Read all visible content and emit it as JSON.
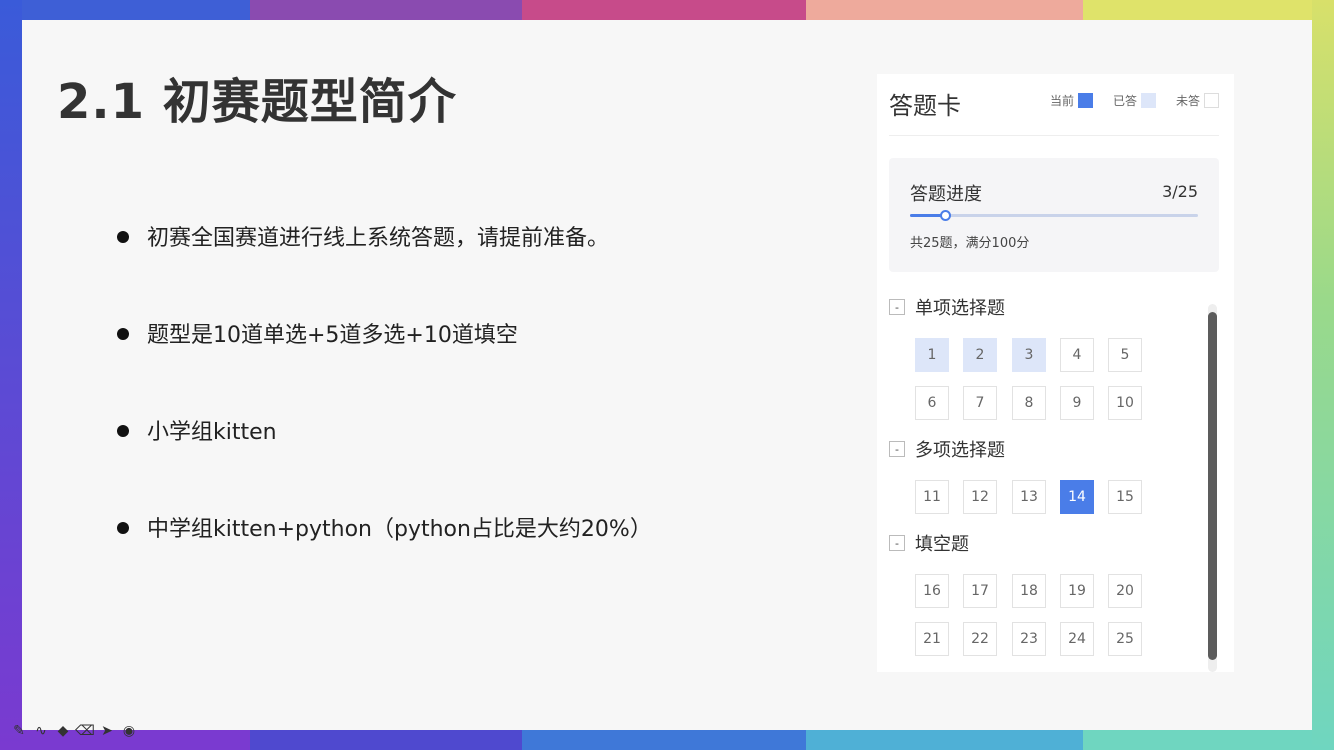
{
  "slide": {
    "title": "2.1 初赛题型简介",
    "bullets": [
      "初赛全国赛道进行线上系统答题，请提前准备。",
      "题型是10道单选+5道多选+10道填空",
      "小学组kitten",
      "中学组kitten+python（python占比是大约20%）"
    ]
  },
  "card": {
    "title": "答题卡",
    "legend": {
      "current": "当前",
      "answered": "已答",
      "unanswered": "未答"
    },
    "progress": {
      "label": "答题进度",
      "count": "3/25",
      "fraction": 0.12,
      "note": "共25题，满分100分"
    },
    "sections": [
      {
        "title": "单项选择题",
        "toggle": "-",
        "questions": [
          "1",
          "2",
          "3",
          "4",
          "5",
          "6",
          "7",
          "8",
          "9",
          "10"
        ]
      },
      {
        "title": "多项选择题",
        "toggle": "-",
        "questions": [
          "11",
          "12",
          "13",
          "14",
          "15"
        ]
      },
      {
        "title": "填空题",
        "toggle": "-",
        "questions": [
          "16",
          "17",
          "18",
          "19",
          "20",
          "21",
          "22",
          "23",
          "24",
          "25"
        ]
      }
    ],
    "answered": [
      "1",
      "2",
      "3"
    ],
    "current": "14"
  },
  "colors": {
    "accent": "#4a7de8",
    "answered": "#dde6f9"
  },
  "toolbar": [
    "pen-icon",
    "curve-icon",
    "marker-icon",
    "eraser-icon",
    "pointer-icon",
    "record-icon"
  ]
}
